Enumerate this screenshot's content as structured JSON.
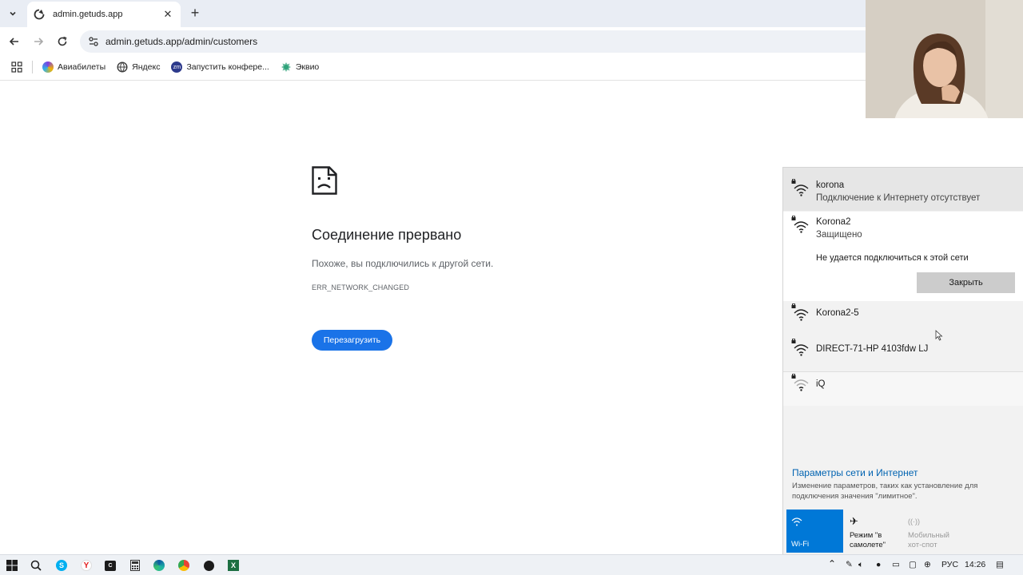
{
  "browser": {
    "tab": {
      "title": "admin.getuds.app"
    },
    "address_bar": {
      "url": "admin.getuds.app/admin/customers"
    },
    "bookmarks": [
      {
        "label": "Авиабилеты",
        "icon": "aviasales-icon",
        "color": "#7b3fe4"
      },
      {
        "label": "Яндекс",
        "icon": "yandex-globe-icon",
        "color": "#3c3c3c"
      },
      {
        "label": "Запустить конфере...",
        "icon": "zoom-icon",
        "color": "#2d3a8c"
      },
      {
        "label": "Эквио",
        "icon": "ekvio-icon",
        "color": "#2fa37a"
      }
    ]
  },
  "error_page": {
    "title": "Соединение прервано",
    "description": "Похоже, вы подключились к другой сети.",
    "code": "ERR_NETWORK_CHANGED",
    "reload_label": "Перезагрузить"
  },
  "wifi_flyout": {
    "networks": [
      {
        "name": "korona",
        "status": "Подключение к Интернету отсутствует",
        "secured": true
      },
      {
        "name": "Korona2",
        "status": "Защищено",
        "error": "Не удается подключиться к этой сети",
        "close_label": "Закрыть",
        "secured": true
      },
      {
        "name": "Korona2-5",
        "secured": true
      },
      {
        "name": "DIRECT-71-HP 4103fdw LJ",
        "secured": true
      },
      {
        "name": "iQ",
        "secured": true
      }
    ],
    "settings_link": "Параметры сети и Интернет",
    "settings_desc": "Изменение параметров, таких как установление для подключения значения \"лимитное\".",
    "quick_actions": [
      {
        "label": "Wi-Fi",
        "state": "on"
      },
      {
        "label": "Режим \"в самолете\"",
        "state": "off"
      },
      {
        "label": "Мобильный хот-спот",
        "state": "disabled"
      }
    ]
  },
  "taskbar": {
    "language": "РУС",
    "time": "14:26"
  },
  "colors": {
    "accent": "#0078d7",
    "reload_button": "#1a73e8",
    "link": "#0063b1"
  }
}
